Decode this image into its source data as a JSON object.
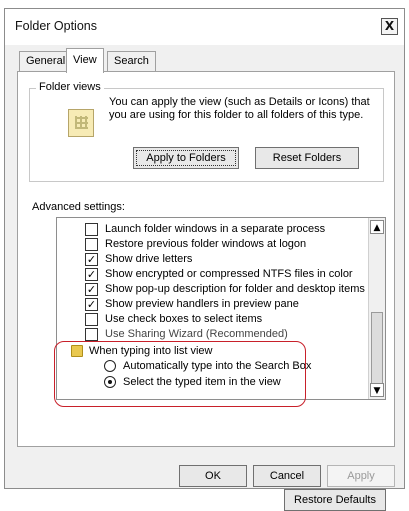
{
  "window": {
    "title": "Folder Options",
    "close_label": "X"
  },
  "tabs": [
    {
      "label": "General"
    },
    {
      "label": "View"
    },
    {
      "label": "Search"
    }
  ],
  "folder_views": {
    "title": "Folder views",
    "description": "You can apply the view (such as Details or Icons) that you are using for this folder to all folders of this type.",
    "apply_button": "Apply to Folders",
    "reset_button": "Reset Folders"
  },
  "advanced": {
    "label": "Advanced settings:",
    "items": [
      {
        "label": "Launch folder windows in a separate process",
        "checked": false
      },
      {
        "label": "Restore previous folder windows at logon",
        "checked": false
      },
      {
        "label": "Show drive letters",
        "checked": true
      },
      {
        "label": "Show encrypted or compressed NTFS files in color",
        "checked": true
      },
      {
        "label": "Show pop-up description for folder and desktop items",
        "checked": true
      },
      {
        "label": "Show preview handlers in preview pane",
        "checked": true
      },
      {
        "label": "Use check boxes to select items",
        "checked": false
      },
      {
        "label": "Use Sharing Wizard (Recommended)",
        "checked": false
      }
    ],
    "folder_item": "When typing into list view",
    "radio_items": [
      {
        "label": "Automatically type into the Search Box",
        "selected": false
      },
      {
        "label": "Select the typed item in the view",
        "selected": true
      }
    ]
  },
  "restore_defaults": "Restore Defaults",
  "footer": {
    "ok": "OK",
    "cancel": "Cancel",
    "apply": "Apply"
  },
  "highlight_color": "#c8202a"
}
